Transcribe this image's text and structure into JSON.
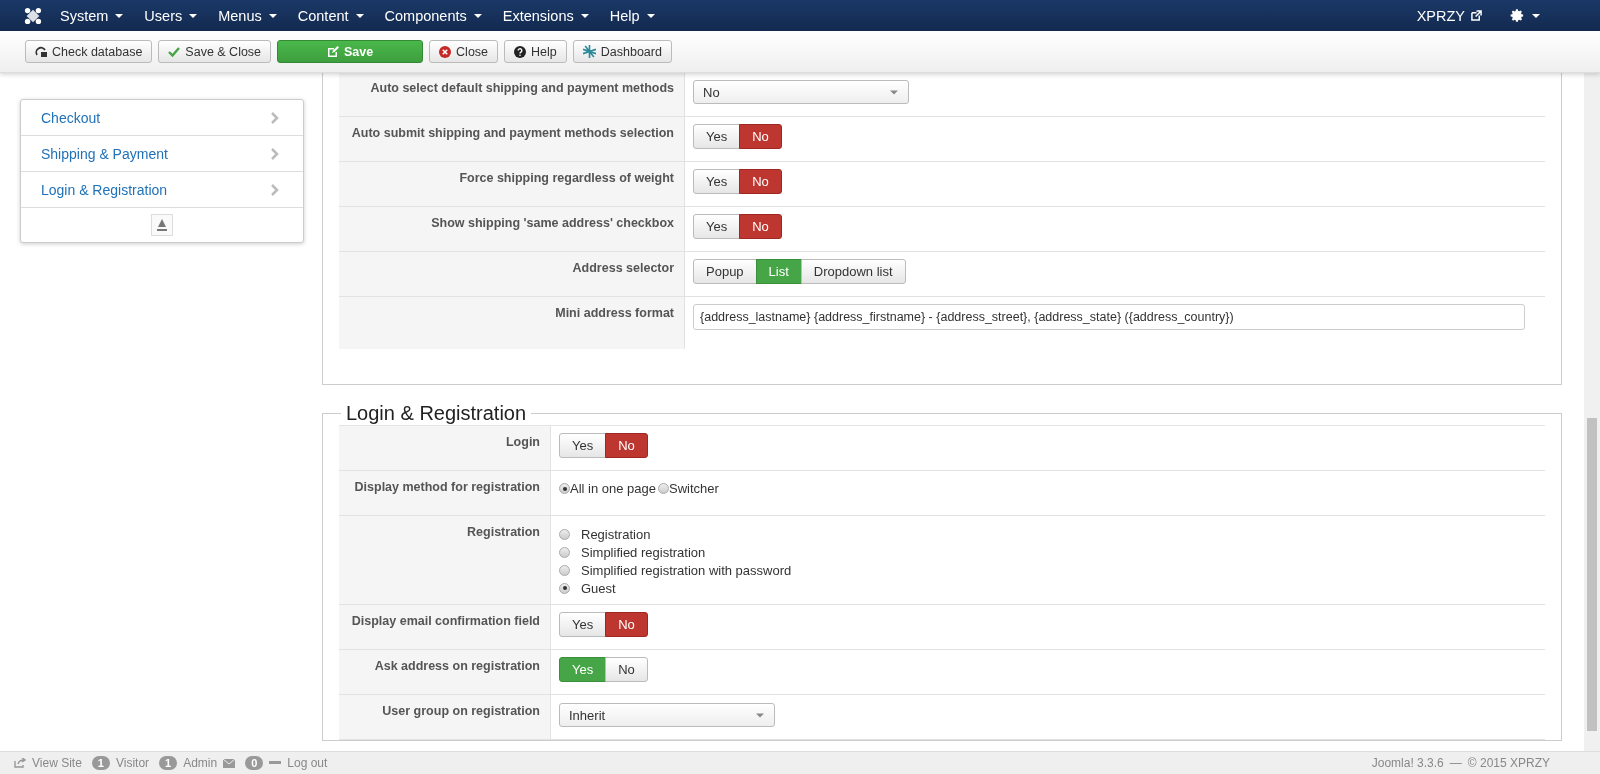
{
  "menu": {
    "items": [
      {
        "label": "System"
      },
      {
        "label": "Users"
      },
      {
        "label": "Menus"
      },
      {
        "label": "Content"
      },
      {
        "label": "Components"
      },
      {
        "label": "Extensions"
      },
      {
        "label": "Help"
      }
    ],
    "site": "XPRZY"
  },
  "toolbar": [
    {
      "label": "Check database",
      "kind": "default"
    },
    {
      "label": "Save & Close",
      "kind": "default"
    },
    {
      "label": "Save",
      "kind": "primary"
    },
    {
      "label": "Close",
      "kind": "default"
    },
    {
      "label": "Help",
      "kind": "default"
    },
    {
      "label": "Dashboard",
      "kind": "default"
    }
  ],
  "sidebar": {
    "items": [
      {
        "label": "Checkout"
      },
      {
        "label": "Shipping & Payment"
      },
      {
        "label": "Login & Registration"
      }
    ]
  },
  "sections": [
    {
      "rows": [
        {
          "label": "Auto select default shipping and payment methods",
          "kind": "select",
          "value": "No"
        },
        {
          "label": "Auto submit shipping and payment methods selection",
          "kind": "toggle",
          "options": [
            {
              "label": "Yes",
              "selected": false
            },
            {
              "label": "No",
              "selected": true
            }
          ]
        },
        {
          "label": "Force shipping regardless of weight",
          "kind": "toggle",
          "options": [
            {
              "label": "Yes",
              "selected": false
            },
            {
              "label": "No",
              "selected": true
            }
          ]
        },
        {
          "label": "Show shipping 'same address' checkbox",
          "kind": "toggle",
          "options": [
            {
              "label": "Yes",
              "selected": false
            },
            {
              "label": "No",
              "selected": true
            }
          ]
        },
        {
          "label": "Address selector",
          "kind": "toggle",
          "options": [
            {
              "label": "Popup",
              "selected": false
            },
            {
              "label": "List",
              "selected": true
            },
            {
              "label": "Dropdown list",
              "selected": false
            }
          ]
        },
        {
          "label": "Mini address format",
          "kind": "text",
          "value": "{address_lastname} {address_firstname} - {address_street}, {address_state} ({address_country})"
        }
      ]
    },
    {
      "legend": "Login & Registration",
      "rows": [
        {
          "label": "Login",
          "kind": "toggle",
          "options": [
            {
              "label": "Yes",
              "selected": false
            },
            {
              "label": "No",
              "selected": true
            }
          ]
        },
        {
          "label": "Display method for registration",
          "kind": "radio-inline",
          "options": [
            {
              "label": "All in one page",
              "selected": true
            },
            {
              "label": "Switcher",
              "selected": false
            }
          ]
        },
        {
          "label": "Registration",
          "kind": "radio-list",
          "options": [
            {
              "label": "Registration",
              "selected": false
            },
            {
              "label": "Simplified registration",
              "selected": false
            },
            {
              "label": "Simplified registration with password",
              "selected": false
            },
            {
              "label": "Guest",
              "selected": true
            }
          ]
        },
        {
          "label": "Display email confirmation field",
          "kind": "toggle",
          "options": [
            {
              "label": "Yes",
              "selected": false
            },
            {
              "label": "No",
              "selected": true
            }
          ]
        },
        {
          "label": "Ask address on registration",
          "kind": "toggle",
          "options": [
            {
              "label": "Yes",
              "selected": true
            },
            {
              "label": "No",
              "selected": false
            }
          ]
        },
        {
          "label": "User group on registration",
          "kind": "select",
          "value": "Inherit"
        }
      ]
    }
  ],
  "status_bar": {
    "view_site": "View Site",
    "visitors": "1",
    "visitors_label": "Visitor",
    "admins": "1",
    "admins_label": "Admin",
    "messages": "0",
    "logout": "Log out",
    "version": "Joomla! 3.3.6",
    "separator": "—",
    "copyright": "© 2015 XPRZY"
  }
}
